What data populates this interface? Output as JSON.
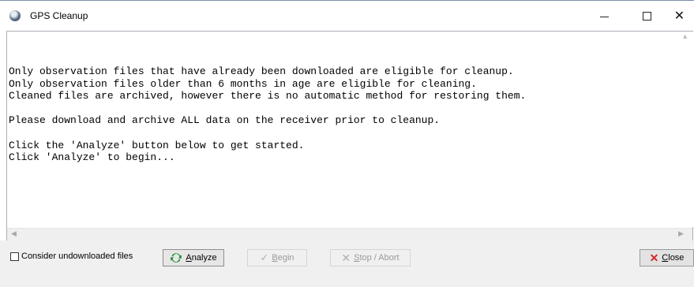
{
  "window": {
    "title": "GPS Cleanup",
    "minimize_glyph": "",
    "close_glyph": "✕"
  },
  "log": {
    "text": "Only observation files that have already been downloaded are eligible for cleanup.\nOnly observation files older than 6 months in age are eligible for cleaning.\nCleaned files are archived, however there is no automatic method for restoring them.\n\nPlease download and archive ALL data on the receiver prior to cleanup.\n\nClick the 'Analyze' button below to get started.\nClick 'Analyze' to begin..."
  },
  "options": {
    "consider_undownloaded_label": "Consider undownloaded  files",
    "consider_undownloaded_checked": false
  },
  "buttons": {
    "analyze": {
      "accel": "A",
      "rest": "nalyze",
      "icon": "refresh-icon"
    },
    "begin": {
      "accel": "B",
      "rest": "egin",
      "icon": "checkmark-icon",
      "enabled": false
    },
    "stop": {
      "accel": "S",
      "rest": "top / Abort",
      "icon": "x-icon",
      "enabled": false
    },
    "close": {
      "accel": "C",
      "rest": "lose",
      "icon": "red-x-icon"
    }
  },
  "colors": {
    "close_icon": "#d8262a",
    "refresh_icon": "#1f8a2e",
    "disabled_text": "#9a9a9a"
  }
}
